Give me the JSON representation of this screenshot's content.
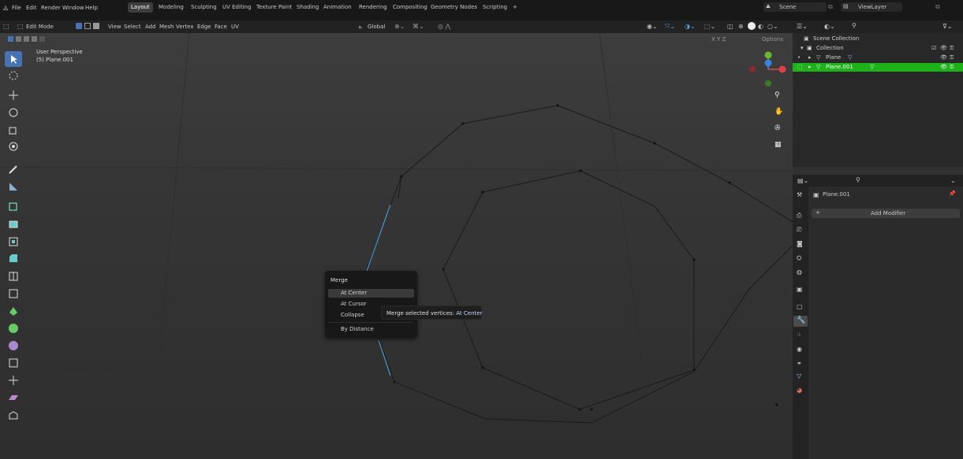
{
  "topbar": {
    "menus": [
      "File",
      "Edit",
      "Render",
      "Window",
      "Help"
    ],
    "workspaces": [
      "Layout",
      "Modeling",
      "Sculpting",
      "UV Editing",
      "Texture Paint",
      "Shading",
      "Animation",
      "Rendering",
      "Compositing",
      "Geometry Nodes",
      "Scripting"
    ],
    "active_workspace": "Layout",
    "add_tab": "+",
    "scene_label": "Scene",
    "viewlayer_label": "ViewLayer"
  },
  "viewport_header": {
    "mode": "Edit Mode",
    "menus": [
      "View",
      "Select",
      "Add",
      "Mesh",
      "Vertex",
      "Edge",
      "Face",
      "UV"
    ],
    "transform_orientation": "Global",
    "axes": "X Y Z",
    "options": "Options"
  },
  "viewport": {
    "perspective": "User Perspective",
    "object_info": "(5) Plane.001"
  },
  "outliner": {
    "title": "Scene Collection",
    "rows": [
      "Collection",
      "Plane",
      "Plane.001"
    ]
  },
  "properties": {
    "object_name": "Plane.001",
    "add_modifier": "Add Modifier"
  },
  "merge_menu": {
    "title": "Merge",
    "items": [
      "At Center",
      "At Cursor",
      "Collapse",
      "By Distance"
    ]
  },
  "tooltip": {
    "text": "Merge selected vertices:",
    "value": "At Center"
  },
  "colors": {
    "accent": "#4772b3",
    "selected_row": "#1db218",
    "x_axis": "#e0414a",
    "y_axis": "#6bb82f",
    "z_axis": "#3f7fe0"
  }
}
